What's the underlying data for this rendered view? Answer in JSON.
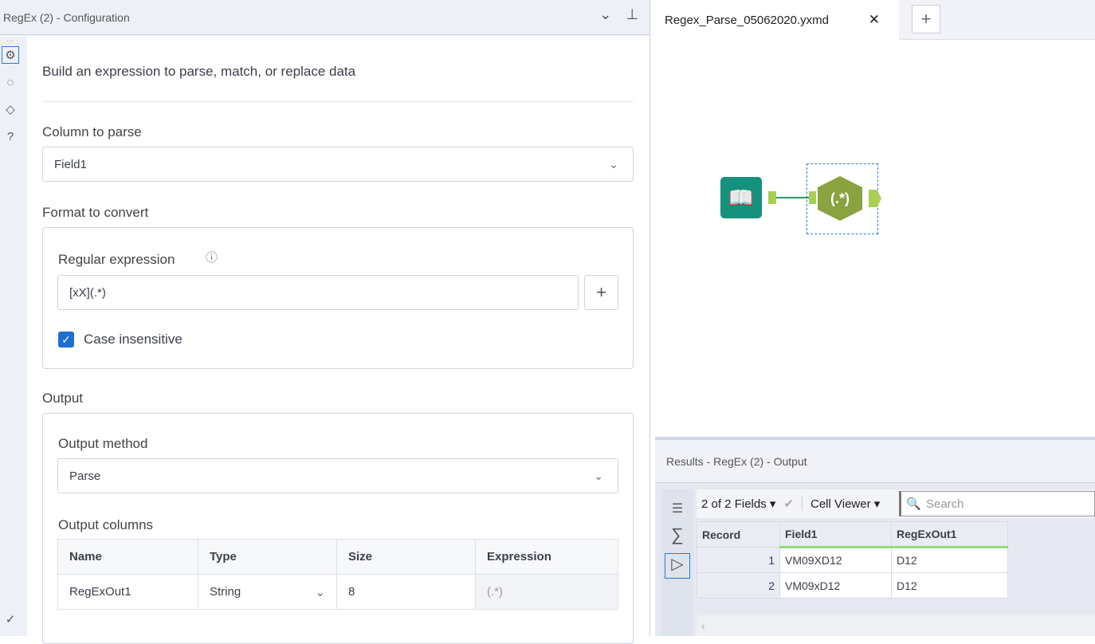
{
  "config": {
    "title": "RegEx (2) - Configuration",
    "description": "Build an expression to parse, match, or replace data",
    "column_label": "Column to parse",
    "column_value": "Field1",
    "format_label": "Format to convert",
    "regex_label": "Regular expression",
    "regex_value": "[xX](.*)",
    "case_label": "Case insensitive",
    "output_label": "Output",
    "method_label": "Output method",
    "method_value": "Parse",
    "columns_label": "Output columns",
    "columns_headers": [
      "Name",
      "Type",
      "Size",
      "Expression"
    ],
    "columns_rows": [
      [
        "RegExOut1",
        "String",
        "8",
        "(.*)"
      ]
    ]
  },
  "canvas": {
    "tab": "Regex_Parse_05062020.yxmd",
    "tool_label": "(.*)"
  },
  "results": {
    "title": "Results - RegEx (2) - Output",
    "fields": "2 of 2 Fields",
    "cell_viewer": "Cell Viewer",
    "search_placeholder": "Search",
    "headers": [
      "Record",
      "Field1",
      "RegExOut1"
    ],
    "rows": [
      [
        "1",
        "VM09XD12",
        "D12"
      ],
      [
        "2",
        "VM09xD12",
        "D12"
      ]
    ]
  }
}
